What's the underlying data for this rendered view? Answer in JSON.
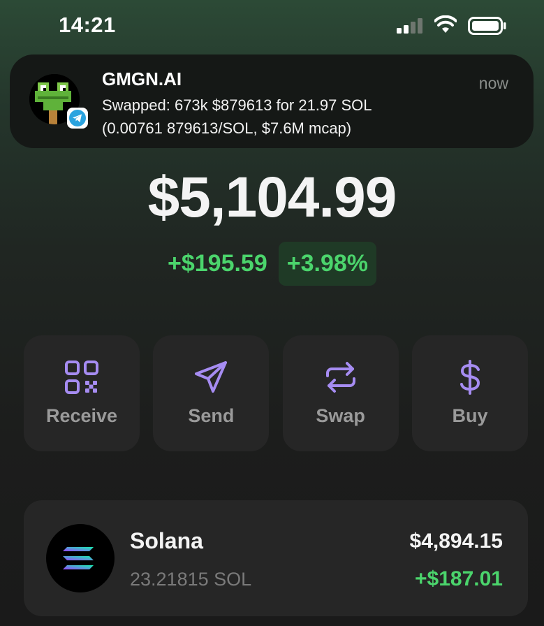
{
  "status_bar": {
    "time": "14:21",
    "signal_icon": "cellular-signal-icon",
    "wifi_icon": "wifi-icon",
    "battery_icon": "battery-icon"
  },
  "notification": {
    "app_name": "GMGN.AI",
    "time": "now",
    "line1": "Swapped: 673k $879613 for 21.97 SOL",
    "line2": "(0.00761 879613/SOL, $7.6M mcap)",
    "avatar_icon": "pixel-frog-avatar",
    "badge_icon": "telegram-icon"
  },
  "portfolio": {
    "balance": "$5,104.99",
    "change_abs": "+$195.59",
    "change_pct": "+3.98%"
  },
  "actions": [
    {
      "label": "Receive",
      "icon": "qr-code-icon"
    },
    {
      "label": "Send",
      "icon": "send-icon"
    },
    {
      "label": "Swap",
      "icon": "swap-icon"
    },
    {
      "label": "Buy",
      "icon": "dollar-icon"
    }
  ],
  "assets": [
    {
      "name": "Solana",
      "amount": "23.21815 SOL",
      "value": "$4,894.15",
      "change": "+$187.01",
      "icon": "solana-logo-icon"
    }
  ],
  "colors": {
    "positive": "#4bd46c",
    "accent": "#a68cf2",
    "card": "#262626"
  }
}
